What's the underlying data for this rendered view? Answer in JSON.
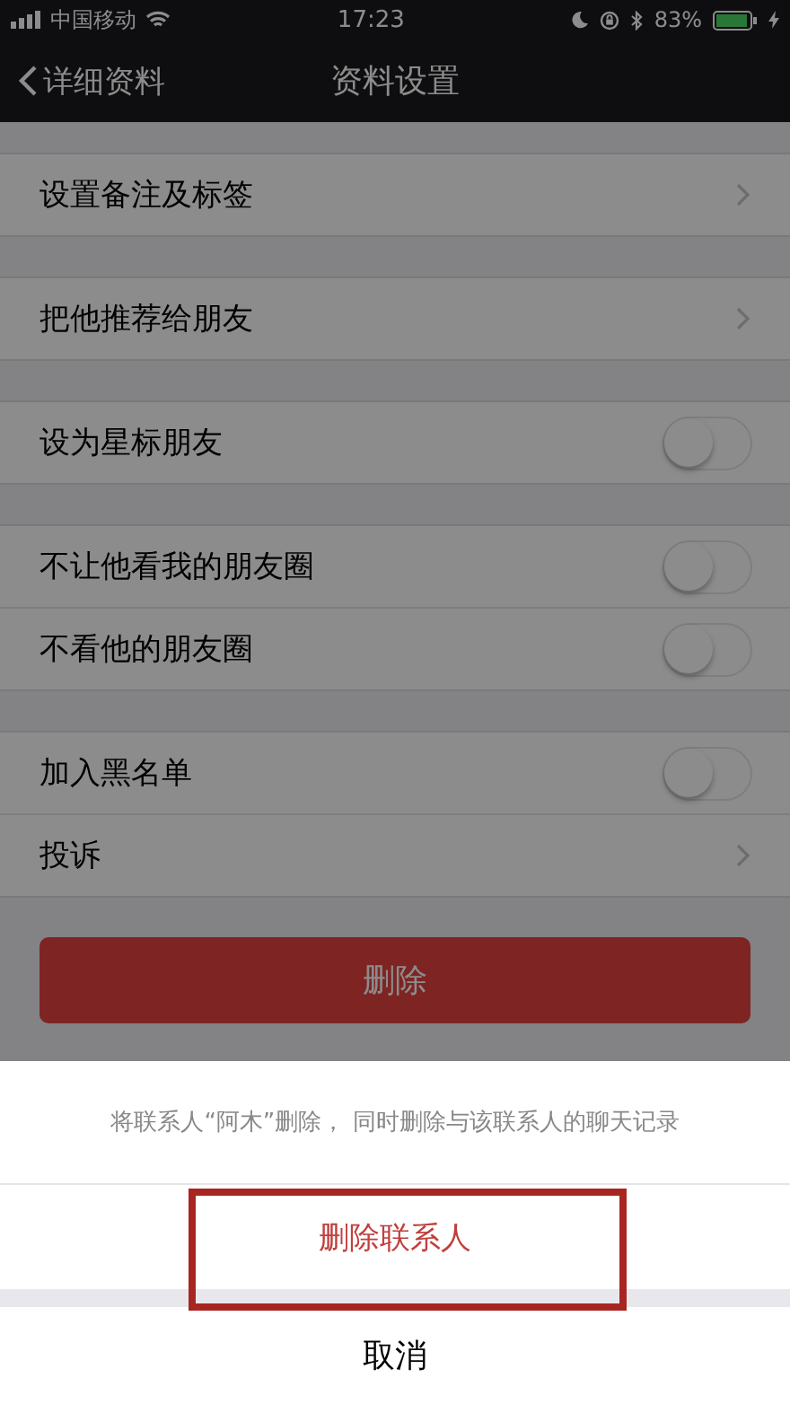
{
  "status_bar": {
    "carrier": "中国移动",
    "time": "17:23",
    "battery_percent": "83%"
  },
  "nav_bar": {
    "back_label": "详细资料",
    "title": "资料设置"
  },
  "groups": [
    {
      "rows": [
        {
          "kind": "link",
          "label": "设置备注及标签"
        }
      ]
    },
    {
      "rows": [
        {
          "kind": "link",
          "label": "把他推荐给朋友"
        }
      ]
    },
    {
      "rows": [
        {
          "kind": "switch",
          "label": "设为星标朋友",
          "on": false
        }
      ]
    },
    {
      "rows": [
        {
          "kind": "switch",
          "label": "不让他看我的朋友圈",
          "on": false
        },
        {
          "kind": "switch",
          "label": "不看他的朋友圈",
          "on": false
        }
      ]
    },
    {
      "rows": [
        {
          "kind": "switch",
          "label": "加入黑名单",
          "on": false
        },
        {
          "kind": "link",
          "label": "投诉"
        }
      ]
    }
  ],
  "delete_button": {
    "label": "删除"
  },
  "action_sheet": {
    "message": "将联系人“阿木”删除， 同时删除与该联系人的聊天记录",
    "actions": [
      {
        "kind": "destructive",
        "label": "删除联系人",
        "highlighted": true
      }
    ],
    "cancel": "取消"
  }
}
